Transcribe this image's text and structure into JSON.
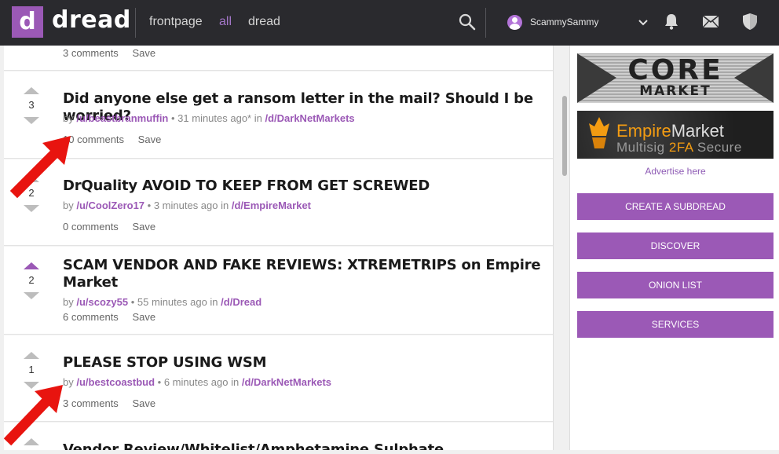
{
  "header": {
    "logo_letter": "d",
    "logo_text": "dread",
    "nav": [
      "frontpage",
      "all",
      "dread"
    ],
    "active_nav": "all",
    "username": "ScammySammy",
    "accent": "#9b59b6"
  },
  "posts": [
    {
      "comments": "3 comments",
      "save": "Save"
    },
    {
      "score": "3",
      "title": "Did anyone else get a ransom letter in the mail? Should I be worried?",
      "by": "by",
      "user": "/u/beastbranmuffin",
      "time": "• 31 minutes ago* in",
      "sub": "/d/DarkNetMarkets",
      "comments": "10 comments",
      "save": "Save"
    },
    {
      "score": "2",
      "title": "DrQuality AVOID TO KEEP FROM GET SCREWED",
      "by": "by",
      "user": "/u/CoolZero17",
      "time": "• 3 minutes ago in",
      "sub": "/d/EmpireMarket",
      "comments": "0 comments",
      "save": "Save"
    },
    {
      "score": "2",
      "title": "SCAM VENDOR AND FAKE REVIEWS: XTREMETRIPS on Empire Market",
      "by": "by",
      "user": "/u/scozy55",
      "time": "• 55 minutes ago in",
      "sub": "/d/Dread",
      "comments": "6 comments",
      "save": "Save",
      "upvoted": true
    },
    {
      "score": "1",
      "title": "PLEASE STOP USING WSM",
      "by": "by",
      "user": "/u/bestcoastbud",
      "time": "• 6 minutes ago in",
      "sub": "/d/DarkNetMarkets",
      "comments": "3 comments",
      "save": "Save"
    },
    {
      "title": "Vendor Review/Whitelist/Amphetamine Sulphate"
    }
  ],
  "sidebar": {
    "ad1_line1": "CORE",
    "ad1_line2": "MARKET",
    "ad2_word1": "Empire",
    "ad2_word2": "Market",
    "ad2_line2a": "Multisig",
    "ad2_line2b": "2FA",
    "ad2_line2c": "Secure",
    "advertise": "Advertise here",
    "buttons": [
      "CREATE A SUBDREAD",
      "DISCOVER",
      "ONION LIST",
      "SERVICES"
    ]
  }
}
